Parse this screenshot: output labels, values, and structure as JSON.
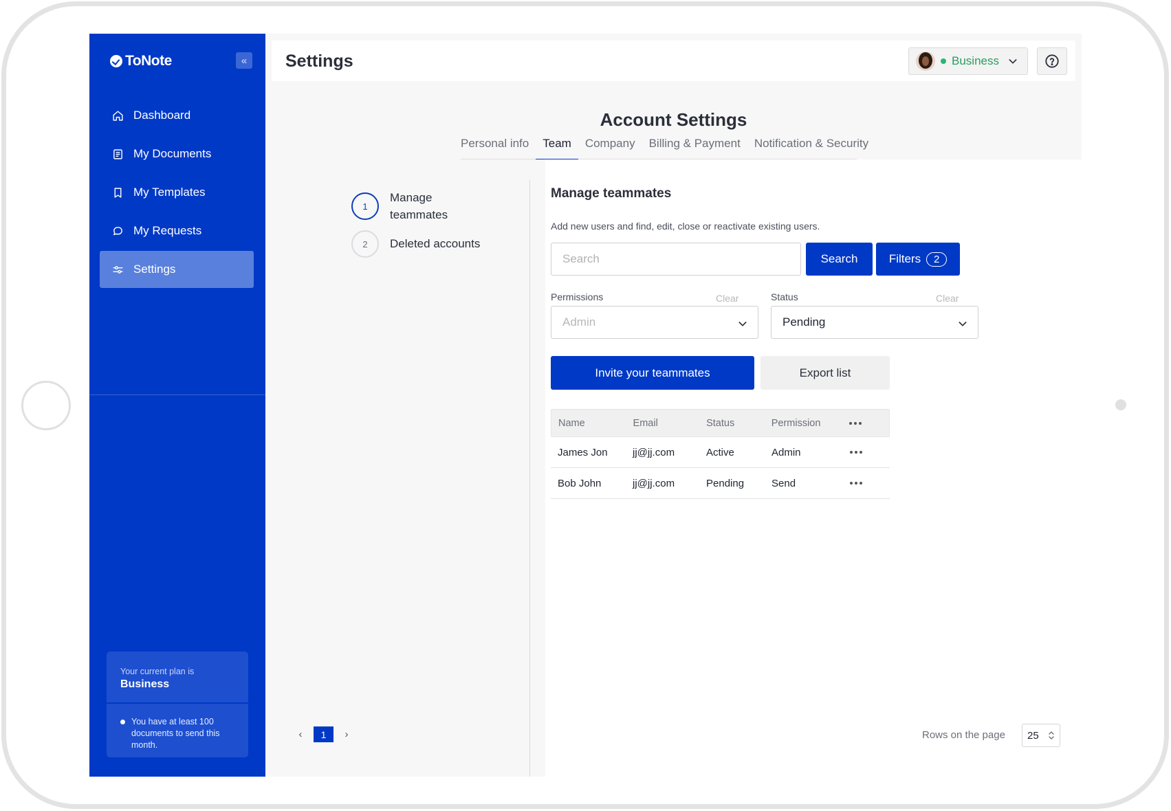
{
  "brand": {
    "name": "ToNote"
  },
  "sidebar": {
    "items": [
      {
        "label": "Dashboard",
        "icon": "home-icon"
      },
      {
        "label": "My Documents",
        "icon": "document-icon"
      },
      {
        "label": "My Templates",
        "icon": "bookmark-icon"
      },
      {
        "label": "My Requests",
        "icon": "chat-bubble-icon"
      },
      {
        "label": "Settings",
        "icon": "settings-sliders-icon",
        "active": true
      }
    ],
    "plan": {
      "label": "Your current plan is",
      "value": "Business",
      "note": "You have at least 100 documents to send this month."
    }
  },
  "header": {
    "title": "Settings",
    "account_name": "Business",
    "status_color": "#2bb673"
  },
  "account_settings": {
    "title": "Account Settings",
    "tabs": [
      {
        "label": "Personal info"
      },
      {
        "label": "Team",
        "active": true
      },
      {
        "label": "Company"
      },
      {
        "label": "Billing & Payment"
      },
      {
        "label": "Notification & Security"
      }
    ]
  },
  "steps": [
    {
      "number": "1",
      "label": "Manage teammates",
      "active": true
    },
    {
      "number": "2",
      "label": "Deleted accounts"
    }
  ],
  "manage": {
    "title": "Manage teammates",
    "subtitle": "Add new users and find, edit, close or reactivate existing users.",
    "search_placeholder": "Search",
    "search_button": "Search",
    "filters_button": "Filters",
    "filters_count": "2",
    "permissions": {
      "label": "Permissions",
      "clear": "Clear",
      "placeholder": "Admin"
    },
    "status": {
      "label": "Status",
      "clear": "Clear",
      "value": "Pending"
    },
    "invite_button": "Invite your teammates",
    "export_button": "Export list"
  },
  "table": {
    "columns": [
      "Name",
      "Email",
      "Status",
      "Permission"
    ],
    "rows": [
      {
        "name": "James Jon",
        "email": "jj@jj.com",
        "status": "Active",
        "permission": "Admin"
      },
      {
        "name": "Bob John",
        "email": "jj@jj.com",
        "status": "Pending",
        "permission": "Send"
      }
    ]
  },
  "pagination": {
    "current_page": "1",
    "rows_label": "Rows on the page",
    "rows_value": "25"
  },
  "colors": {
    "primary": "#0039c6",
    "sidebar_active": "#5880dc",
    "success": "#2bb673"
  }
}
